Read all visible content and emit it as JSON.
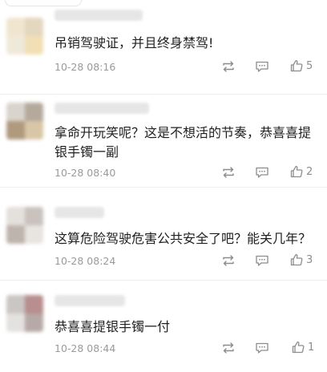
{
  "comments": [
    {
      "text": "吊销驾驶证，并且终身禁驾!",
      "time": "10-28 08:16",
      "likes": "5",
      "repost_icon": "repost-icon",
      "reply_icon": "comment-icon",
      "like_icon": "thumbs-up-icon"
    },
    {
      "text": "拿命开玩笑呢？这是不想活的节奏，恭喜喜提银手镯一副",
      "time": "10-28 08:40",
      "likes": "2",
      "repost_icon": "repost-icon",
      "reply_icon": "comment-icon",
      "like_icon": "thumbs-up-icon"
    },
    {
      "text": "这算危险驾驶危害公共安全了吧？能关几年？",
      "time": "10-28 08:24",
      "likes": "3",
      "repost_icon": "repost-icon",
      "reply_icon": "comment-icon",
      "like_icon": "thumbs-up-icon"
    },
    {
      "text": "恭喜喜提银手镯一付",
      "time": "10-28 08:44",
      "likes": "1",
      "repost_icon": "repost-icon",
      "reply_icon": "comment-icon",
      "like_icon": "thumbs-up-icon"
    }
  ],
  "colors": {
    "text": "#1f1f1f",
    "meta": "#9a9a9a",
    "icon": "#8c8c8c",
    "divider": "#efefef"
  }
}
